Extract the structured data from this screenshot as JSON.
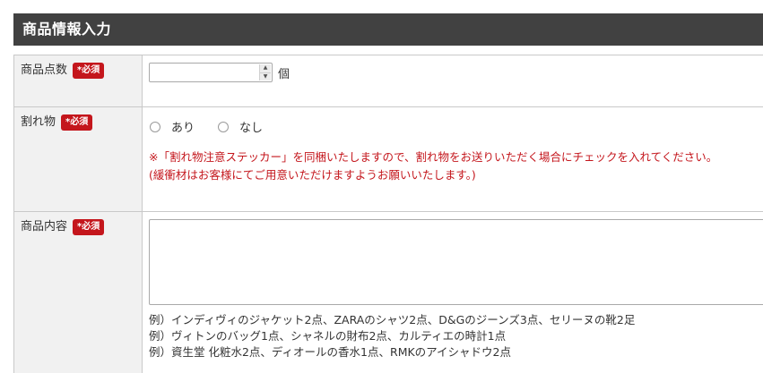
{
  "section": {
    "title": "商品情報入力"
  },
  "required_badge": "*必須",
  "rows": {
    "quantity": {
      "label": "商品点数",
      "value": "",
      "unit": "個"
    },
    "fragile": {
      "label": "割れ物",
      "options": [
        {
          "label": "あり",
          "selected": false
        },
        {
          "label": "なし",
          "selected": false
        }
      ],
      "notice_line1": "※「割れ物注意ステッカー」を同梱いたしますので、割れ物をお送りいただく場合にチェックを入れてください。",
      "notice_line2": "(緩衝材はお客様にてご用意いただけますようお願いいたします。)"
    },
    "contents": {
      "label": "商品内容",
      "value": "",
      "examples": [
        "例）インディヴィのジャケット2点、ZARAのシャツ2点、D&Gのジーンズ3点、セリーヌの靴2足",
        "例）ヴィトンのバッグ1点、シャネルの財布2点、カルティエの時計1点",
        "例）資生堂 化粧水2点、ディオールの香水1点、RMKのアイシャドウ2点"
      ]
    }
  },
  "colors": {
    "header_bg": "#414141",
    "label_bg": "#f1f1f1",
    "badge_bg": "#c4161c",
    "notice_text": "#c4161c",
    "border": "#c9c9c9"
  },
  "icons": {
    "spinner_up": "up-triangle",
    "spinner_down": "down-triangle"
  }
}
